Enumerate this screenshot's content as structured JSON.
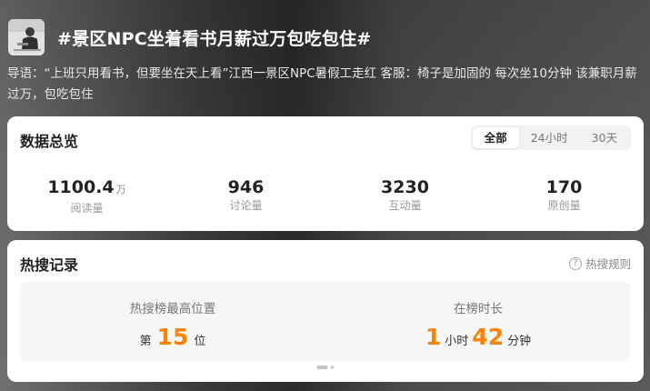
{
  "topic": {
    "title": "#景区NPC坐着看书月薪过万包吃包住#",
    "intro": "导语：“上班只用看书，但要坐在天上看”江西一景区NPC暑假工走红 客服：椅子是加固的 每次坐10分钟 该兼职月薪过万，包吃包住"
  },
  "overview": {
    "title": "数据总览",
    "tabs": [
      {
        "label": "全部",
        "active": true
      },
      {
        "label": "24小时",
        "active": false
      },
      {
        "label": "30天",
        "active": false
      }
    ],
    "stats": [
      {
        "value": "1100.4",
        "unit": "万",
        "label": "阅读量"
      },
      {
        "value": "946",
        "unit": "",
        "label": "讨论量"
      },
      {
        "value": "3230",
        "unit": "",
        "label": "互动量"
      },
      {
        "value": "170",
        "unit": "",
        "label": "原创量"
      }
    ]
  },
  "hot": {
    "title": "热搜记录",
    "rules_label": "热搜规则",
    "rank_label": "热搜榜最高位置",
    "rank_prefix": "第",
    "rank_value": "15",
    "rank_suffix": "位",
    "duration_label": "在榜时长",
    "hours_value": "1",
    "hours_unit": "小时",
    "minutes_value": "42",
    "minutes_unit": "分钟"
  },
  "colors": {
    "accent": "#ff8200"
  },
  "icons": {
    "rules": "question-circle-icon"
  }
}
